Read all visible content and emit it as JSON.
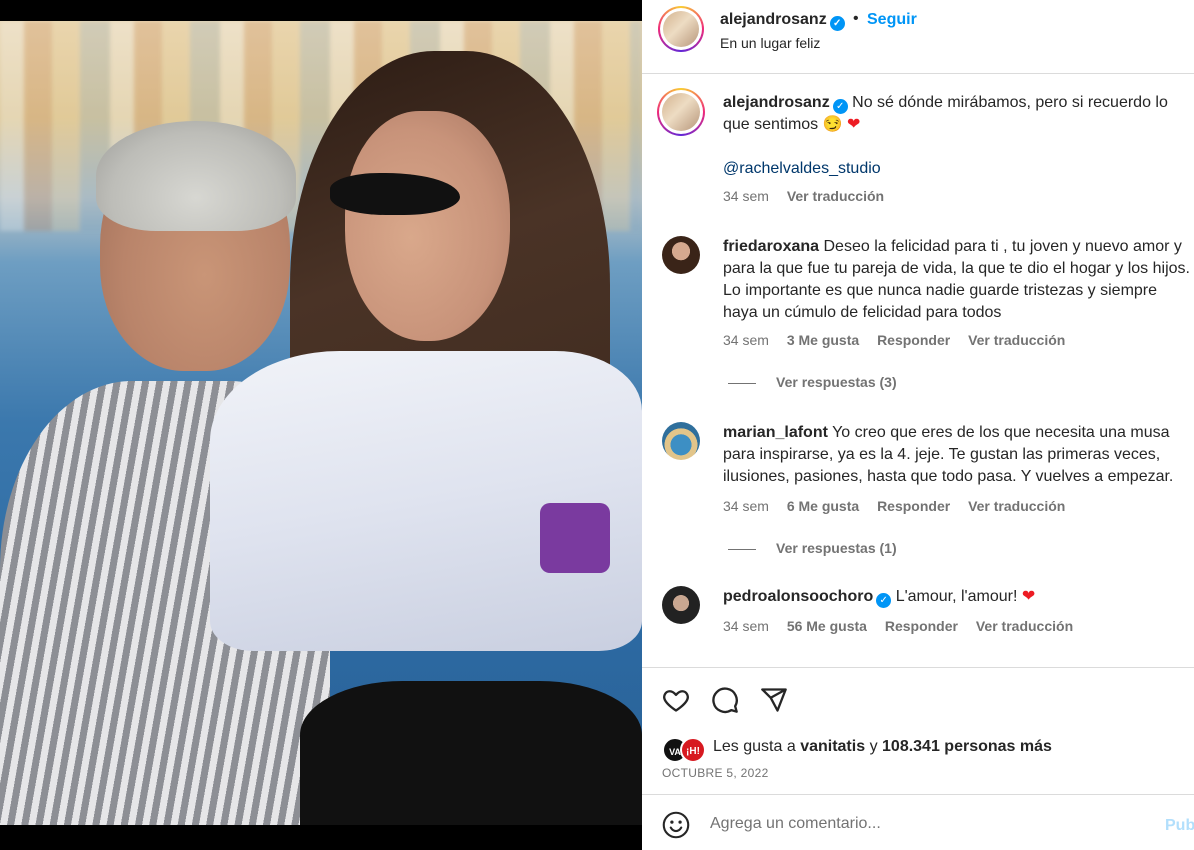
{
  "header": {
    "username": "alejandrosanz",
    "separator": "•",
    "follow_label": "Seguir",
    "location": "En un lugar feliz"
  },
  "caption": {
    "username": "alejandrosanz",
    "text": "No sé dónde mirábamos, pero si recuerdo lo que sentimos 😏",
    "heart": "❤",
    "mention": "@rachelvaldes_studio",
    "time": "34 sem",
    "translate": "Ver traducción"
  },
  "comments": [
    {
      "username": "friedaroxana",
      "text": "Deseo la felicidad para ti , tu joven y nuevo amor y para la que fue tu pareja de vida, la que te dio el hogar y los hijos. Lo importante es que nunca nadie guarde tristezas y siempre haya un cúmulo de felicidad para todos",
      "time": "34 sem",
      "likes": "3 Me gusta",
      "reply": "Responder",
      "translate": "Ver traducción",
      "replies": "Ver respuestas (3)"
    },
    {
      "username": "marian_lafont",
      "text": "Yo creo que eres de los que necesita una musa para inspirarse, ya es la 4. jeje. Te gustan las primeras veces, ilusiones, pasiones, hasta que todo pasa. Y vuelves a empezar.",
      "time": "34 sem",
      "likes": "6 Me gusta",
      "reply": "Responder",
      "translate": "Ver traducción",
      "replies": "Ver respuestas (1)"
    },
    {
      "username": "pedroalonsoochoro",
      "text": "L'amour, l'amour!",
      "heart": "❤",
      "time": "34 sem",
      "likes": "56 Me gusta",
      "reply": "Responder",
      "translate": "Ver traducción"
    }
  ],
  "likes": {
    "badge1": "VA",
    "badge2": "¡H!",
    "prefix": "Les gusta a",
    "user": "vanitatis",
    "middle": "y",
    "count": "108.341 personas más"
  },
  "date": "OCTUBRE 5, 2022",
  "comment_box": {
    "placeholder": "Agrega un comentario...",
    "publish": "Pub"
  },
  "icons": {
    "like": "heart-outline-icon",
    "comment": "speech-bubble-icon",
    "share": "paper-plane-icon",
    "emoji": "smiley-icon",
    "verified": "verified-badge-icon"
  },
  "colors": {
    "link_blue": "#0095f6",
    "mention_blue": "#00376b",
    "secondary_text": "#737373",
    "heart_red": "#ed1c24"
  }
}
